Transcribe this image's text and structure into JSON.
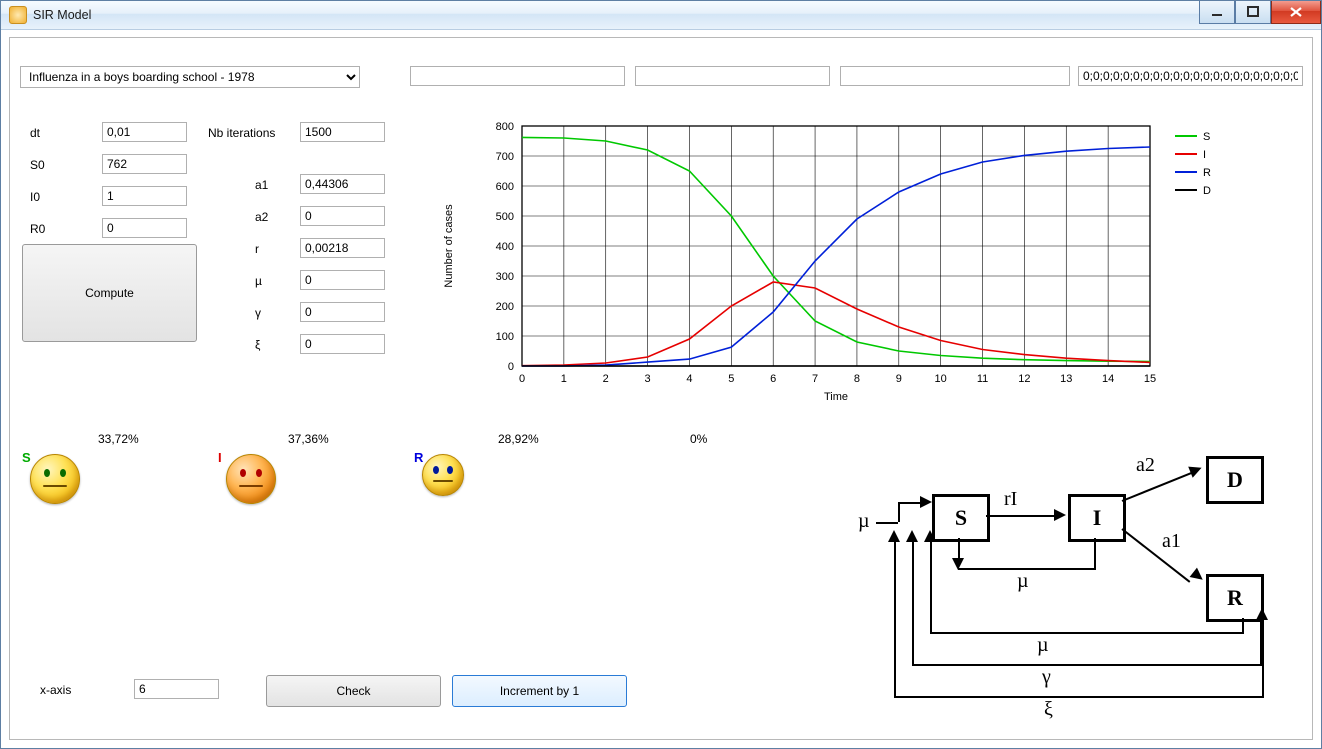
{
  "window": {
    "title": "SIR Model"
  },
  "scenario": {
    "selected": "Influenza in a boys boarding school - 1978"
  },
  "top_fields": {
    "f1": "",
    "f2": "",
    "f3": "",
    "f4": "0;0;0;0;0;0;0;0;0;0;0;0;0;0;0;0;0;0;0;0;0;0;0;0"
  },
  "params_left": {
    "dt": {
      "label": "dt",
      "value": "0,01"
    },
    "S0": {
      "label": "S0",
      "value": "762"
    },
    "I0": {
      "label": "I0",
      "value": "1"
    },
    "R0": {
      "label": "R0",
      "value": "0"
    }
  },
  "params_right": {
    "nb_iter": {
      "label": "Nb iterations",
      "value": "1500"
    },
    "a1": {
      "label": "a1",
      "value": "0,44306"
    },
    "a2": {
      "label": "a2",
      "value": "0"
    },
    "r": {
      "label": "r",
      "value": "0,00218"
    },
    "mu": {
      "label": "µ",
      "value": "0"
    },
    "gamma": {
      "label": "γ",
      "value": "0"
    },
    "xi": {
      "label": "ξ",
      "value": "0"
    }
  },
  "buttons": {
    "compute": "Compute",
    "check": "Check",
    "inc": "Increment by 1"
  },
  "percents": {
    "S": "33,72%",
    "I": "37,36%",
    "R": "28,92%",
    "D": "0%"
  },
  "xaxis": {
    "label": "x-axis",
    "value": "6"
  },
  "chart_data": {
    "type": "line",
    "xlabel": "Time",
    "ylabel": "Number of cases",
    "xlim": [
      0,
      15
    ],
    "ylim": [
      0,
      800
    ],
    "xticks": [
      0,
      1,
      2,
      3,
      4,
      5,
      6,
      7,
      8,
      9,
      10,
      11,
      12,
      13,
      14,
      15
    ],
    "yticks": [
      0,
      100,
      200,
      300,
      400,
      500,
      600,
      700,
      800
    ],
    "legend": [
      "S",
      "I",
      "R",
      "D"
    ],
    "colors": {
      "S": "#00c800",
      "I": "#e60000",
      "R": "#0020d8",
      "D": "#000000"
    },
    "x": [
      0,
      1,
      2,
      3,
      4,
      5,
      6,
      7,
      8,
      9,
      10,
      11,
      12,
      13,
      14,
      15
    ],
    "series": [
      {
        "name": "S",
        "values": [
          762,
          760,
          750,
          720,
          650,
          500,
          300,
          150,
          80,
          50,
          35,
          26,
          21,
          18,
          16,
          15
        ]
      },
      {
        "name": "I",
        "values": [
          1,
          3,
          10,
          30,
          90,
          200,
          280,
          260,
          190,
          130,
          85,
          55,
          38,
          26,
          18,
          12
        ]
      },
      {
        "name": "R",
        "values": [
          0,
          0,
          3,
          13,
          23,
          63,
          180,
          350,
          490,
          580,
          640,
          680,
          702,
          716,
          725,
          730
        ]
      },
      {
        "name": "D",
        "values": [
          0,
          0,
          0,
          0,
          0,
          0,
          0,
          0,
          0,
          0,
          0,
          0,
          0,
          0,
          0,
          0
        ]
      }
    ]
  },
  "diagram": {
    "nodes": [
      "S",
      "I",
      "R",
      "D"
    ],
    "edge_labels": [
      "µ",
      "rI",
      "a2",
      "a1",
      "µ",
      "µ",
      "γ",
      "ξ"
    ]
  }
}
